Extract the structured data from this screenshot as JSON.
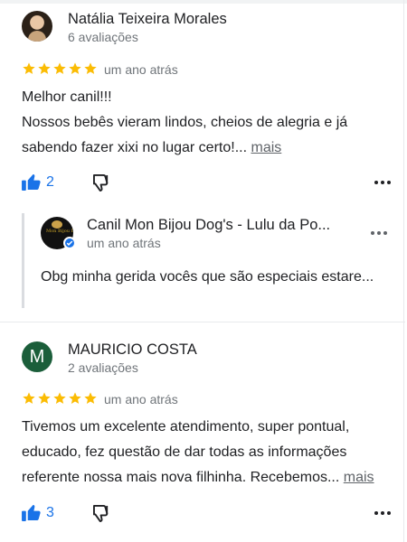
{
  "reviews": [
    {
      "name": "Natália Teixeira Morales",
      "count": "6 avaliações",
      "rating": 5,
      "time": "um ano atrás",
      "line1": "Melhor canil!!!",
      "line2": "Nossos bebês vieram lindos, cheios de alegria e já",
      "line3": "sabendo fazer xixi no lugar certo!...",
      "more": "mais",
      "likes": "2",
      "owner_reply": {
        "name": "Canil Mon Bijou Dog's - Lulu da Po...",
        "time": "um ano atrás",
        "text": "Obg minha gerida vocês que são especiais estare..."
      }
    },
    {
      "avatar_letter": "M",
      "name": "MAURICIO COSTA",
      "count": "2 avaliações",
      "rating": 5,
      "time": "um ano atrás",
      "line1": "Tivemos um excelente atendimento, super pontual,",
      "line2": "educado, fez questão de dar todas as informações",
      "line3": "referente nossa mais nova filhinha. Recebemos...",
      "more": "mais",
      "likes": "3"
    }
  ],
  "colors": {
    "star": "#fbbc04",
    "accent": "#1a73e8",
    "avatar_m": "#1b5e3a"
  },
  "icons": [
    "avatar-photo",
    "star-icon",
    "thumb-up-icon",
    "thumb-down-icon",
    "more-vert-icon",
    "verified-badge-icon",
    "business-logo"
  ]
}
